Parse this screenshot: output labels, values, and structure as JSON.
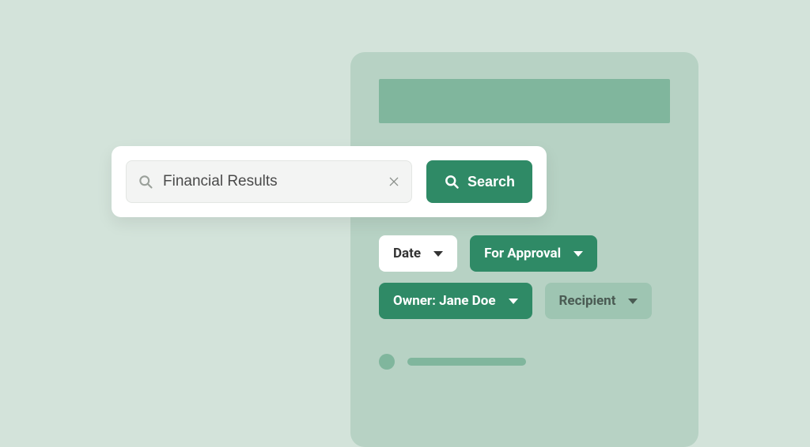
{
  "search": {
    "value": "Financial Results",
    "button_label": "Search"
  },
  "filters": {
    "date_label": "Date",
    "status_label": "For Approval",
    "owner_label": "Owner: Jane Doe",
    "recipient_label": "Recipient"
  },
  "colors": {
    "accent": "#2f8a66",
    "muted": "#9ec5b2",
    "panel": "#b7d2c4",
    "bg": "#d3e3da"
  }
}
